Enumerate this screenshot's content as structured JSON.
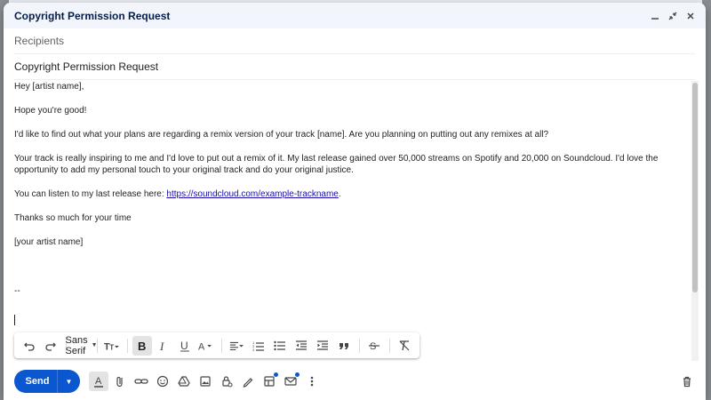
{
  "window": {
    "title": "Copyright Permission Request"
  },
  "fields": {
    "recipients_placeholder": "Recipients",
    "subject_value": "Copyright Permission Request"
  },
  "body": {
    "greeting": "Hey [artist name],",
    "line1": "Hope you're good!",
    "line2": "I'd like to find out what your plans are regarding a remix version of your track [name]. Are you planning on putting out any remixes at all?",
    "line3": "Your track is really inspiring to me and I'd love to put out a remix of it. My last release gained over 50,000 streams on Spotify and 20,000 on Soundcloud. I'd love the opportunity to add my personal touch to your original track and do your original justice.",
    "listen_prefix": "You can listen to my last release here: ",
    "listen_link": "https://soundcloud.com/example-trackname",
    "listen_suffix": ".",
    "thanks": "Thanks so much for your time",
    "signature": "[your artist name]",
    "sig_sep": "--"
  },
  "format_toolbar": {
    "font": "Sans Serif",
    "bold_active": true
  },
  "actions": {
    "send_label": "Send"
  },
  "colors": {
    "accent": "#0b57d0",
    "title_bg": "#f2f6fc"
  }
}
